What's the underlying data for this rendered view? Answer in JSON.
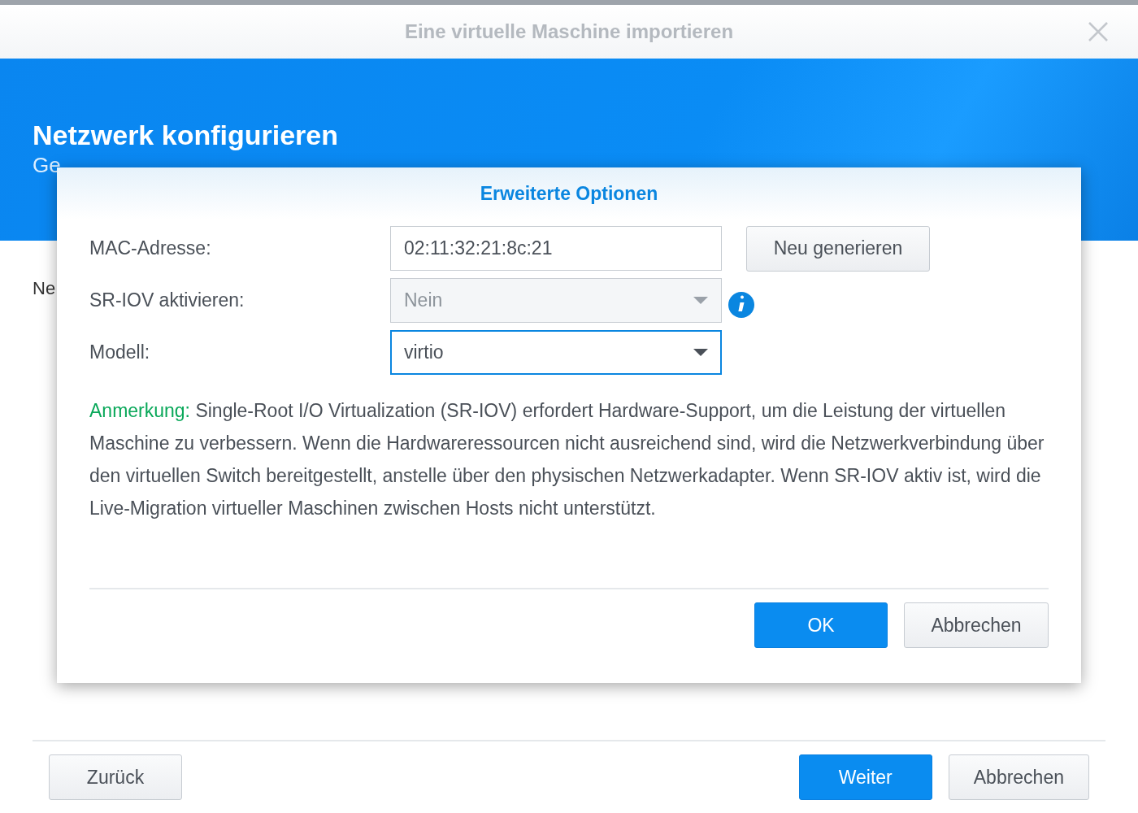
{
  "window": {
    "title": "Eine virtuelle Maschine importieren"
  },
  "header": {
    "title": "Netzwerk konfigurieren",
    "subtitle": "Ge"
  },
  "body": {
    "label": "Ne"
  },
  "footer": {
    "buttons": [
      {
        "label": "Zurück",
        "kind": "default"
      },
      {
        "label": "Weiter",
        "kind": "primary"
      },
      {
        "label": "Abbrechen",
        "kind": "default"
      }
    ]
  },
  "dialog": {
    "title": "Erweiterte Optionen",
    "fields": [
      {
        "label": "MAC-Adresse:",
        "kind": "text",
        "value": "02:11:32:21:8c:21",
        "disabled": false,
        "focused": false,
        "action": "Neu generieren"
      },
      {
        "label": "SR-IOV aktivieren:",
        "kind": "select",
        "value": "Nein",
        "disabled": true,
        "focused": false,
        "info": true
      },
      {
        "label": "Modell:",
        "kind": "select",
        "value": "virtio",
        "disabled": false,
        "focused": true
      }
    ],
    "note": {
      "prefix": "Anmerkung:",
      "text": "Single-Root I/O Virtualization (SR-IOV) erfordert Hardware-Support, um die Leistung der virtuellen Maschine zu verbessern. Wenn die Hardwareressourcen nicht ausreichend sind, wird die Netzwerkverbindung über den virtuellen Switch bereitgestellt, anstelle über den physischen Netzwerkadapter. Wenn SR-IOV aktiv ist, wird die Live-Migration virtueller Maschinen zwischen Hosts nicht unterstützt."
    },
    "buttons": [
      {
        "label": "OK",
        "kind": "primary"
      },
      {
        "label": "Abbrechen",
        "kind": "default"
      }
    ]
  }
}
